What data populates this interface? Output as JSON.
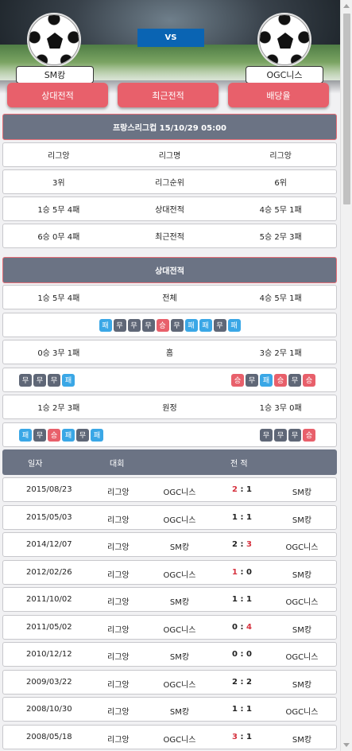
{
  "hero": {
    "vs": "VS",
    "home_team": "SM캉",
    "away_team": "OGC니스"
  },
  "tabs": [
    "상대전적",
    "최근전적",
    "배당율"
  ],
  "match_header": "프랑스리그컵 15/10/29 05:00",
  "summary_rows": [
    {
      "home": "리그앙",
      "label": "리그명",
      "away": "리그앙"
    },
    {
      "home": "3위",
      "label": "리그순위",
      "away": "6위"
    },
    {
      "home": "1승 5무 4패",
      "label": "상대전적",
      "away": "4승 5무 1패"
    },
    {
      "home": "6승 0무 4패",
      "label": "최근전적",
      "away": "5승 2무 3패"
    }
  ],
  "h2h_header": "상대전적",
  "h2h_total": {
    "home": "1승 5무 4패",
    "label": "전체",
    "away": "4승 5무 1패"
  },
  "h2h_total_badges": [
    "패",
    "무",
    "무",
    "무",
    "승",
    "무",
    "패",
    "패",
    "무",
    "패"
  ],
  "h2h_home": {
    "home": "0승 3무 1패",
    "label": "홈",
    "away": "3승 2무 1패"
  },
  "h2h_home_badges_left": [
    "무",
    "무",
    "무",
    "패"
  ],
  "h2h_home_badges_right": [
    "승",
    "무",
    "패",
    "승",
    "무",
    "승"
  ],
  "h2h_away": {
    "home": "1승 2무 3패",
    "label": "원정",
    "away": "1승 3무 0패"
  },
  "h2h_away_badges_left": [
    "패",
    "무",
    "승",
    "패",
    "무",
    "패"
  ],
  "h2h_away_badges_right": [
    "무",
    "무",
    "무",
    "승"
  ],
  "table_header": {
    "date": "일자",
    "competition": "대회",
    "record": "전 적"
  },
  "matches": [
    {
      "date": "2015/08/23",
      "league": "리그앙",
      "home": "OGC니스",
      "hs": "2",
      "as": "1",
      "away": "SM캉",
      "red": "home"
    },
    {
      "date": "2015/05/03",
      "league": "리그앙",
      "home": "OGC니스",
      "hs": "1",
      "as": "1",
      "away": "SM캉",
      "red": ""
    },
    {
      "date": "2014/12/07",
      "league": "리그앙",
      "home": "SM캉",
      "hs": "2",
      "as": "3",
      "away": "OGC니스",
      "red": "away"
    },
    {
      "date": "2012/02/26",
      "league": "리그앙",
      "home": "OGC니스",
      "hs": "1",
      "as": "0",
      "away": "SM캉",
      "red": "home"
    },
    {
      "date": "2011/10/02",
      "league": "리그앙",
      "home": "SM캉",
      "hs": "1",
      "as": "1",
      "away": "OGC니스",
      "red": ""
    },
    {
      "date": "2011/05/02",
      "league": "리그앙",
      "home": "OGC니스",
      "hs": "0",
      "as": "4",
      "away": "SM캉",
      "red": "away"
    },
    {
      "date": "2010/12/12",
      "league": "리그앙",
      "home": "SM캉",
      "hs": "0",
      "as": "0",
      "away": "OGC니스",
      "red": ""
    },
    {
      "date": "2009/03/22",
      "league": "리그앙",
      "home": "OGC니스",
      "hs": "2",
      "as": "2",
      "away": "SM캉",
      "red": ""
    },
    {
      "date": "2008/10/30",
      "league": "리그앙",
      "home": "SM캉",
      "hs": "1",
      "as": "1",
      "away": "OGC니스",
      "red": ""
    },
    {
      "date": "2008/05/18",
      "league": "리그앙",
      "home": "OGC니스",
      "hs": "3",
      "as": "1",
      "away": "SM캉",
      "red": "home"
    }
  ],
  "colors": {
    "tab": "#e8606b",
    "header": "#6b7384",
    "win": "#e8606b",
    "draw": "#5f6777",
    "loss": "#3aa7e6",
    "vs": "#0a64b3"
  }
}
